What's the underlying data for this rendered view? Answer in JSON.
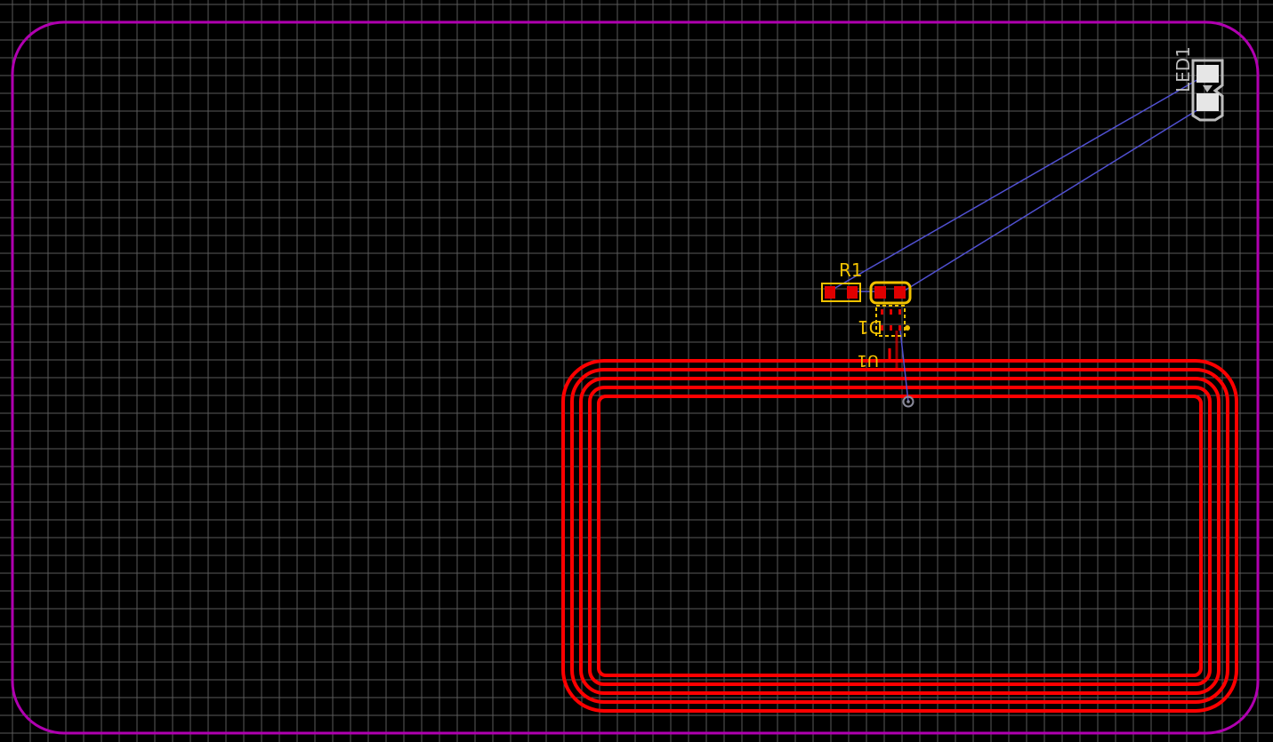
{
  "canvas": {
    "background": "#000000",
    "grid_color": "#5a5a5a",
    "board_outline_color": "#b000b0",
    "copper_top_color": "#ff0000",
    "silkscreen_color": "#f2c200",
    "ratsnest_color": "#5050d0",
    "component_outline_color": "#bdbdbd",
    "via_color": "#8a8a9a"
  },
  "components": {
    "r1": {
      "designator": "R1",
      "icon": "resistor-footprint-icon"
    },
    "d1": {
      "designator": "D1",
      "icon": "diode-footprint-icon"
    },
    "u1": {
      "designator": "U1",
      "icon": "ic-footprint-icon"
    },
    "led1": {
      "designator": "LED1",
      "icon": "led-footprint-icon"
    }
  },
  "features": {
    "coil": {
      "name": "antenna-coil",
      "turns": 5
    },
    "via": {
      "name": "coil-via"
    }
  }
}
